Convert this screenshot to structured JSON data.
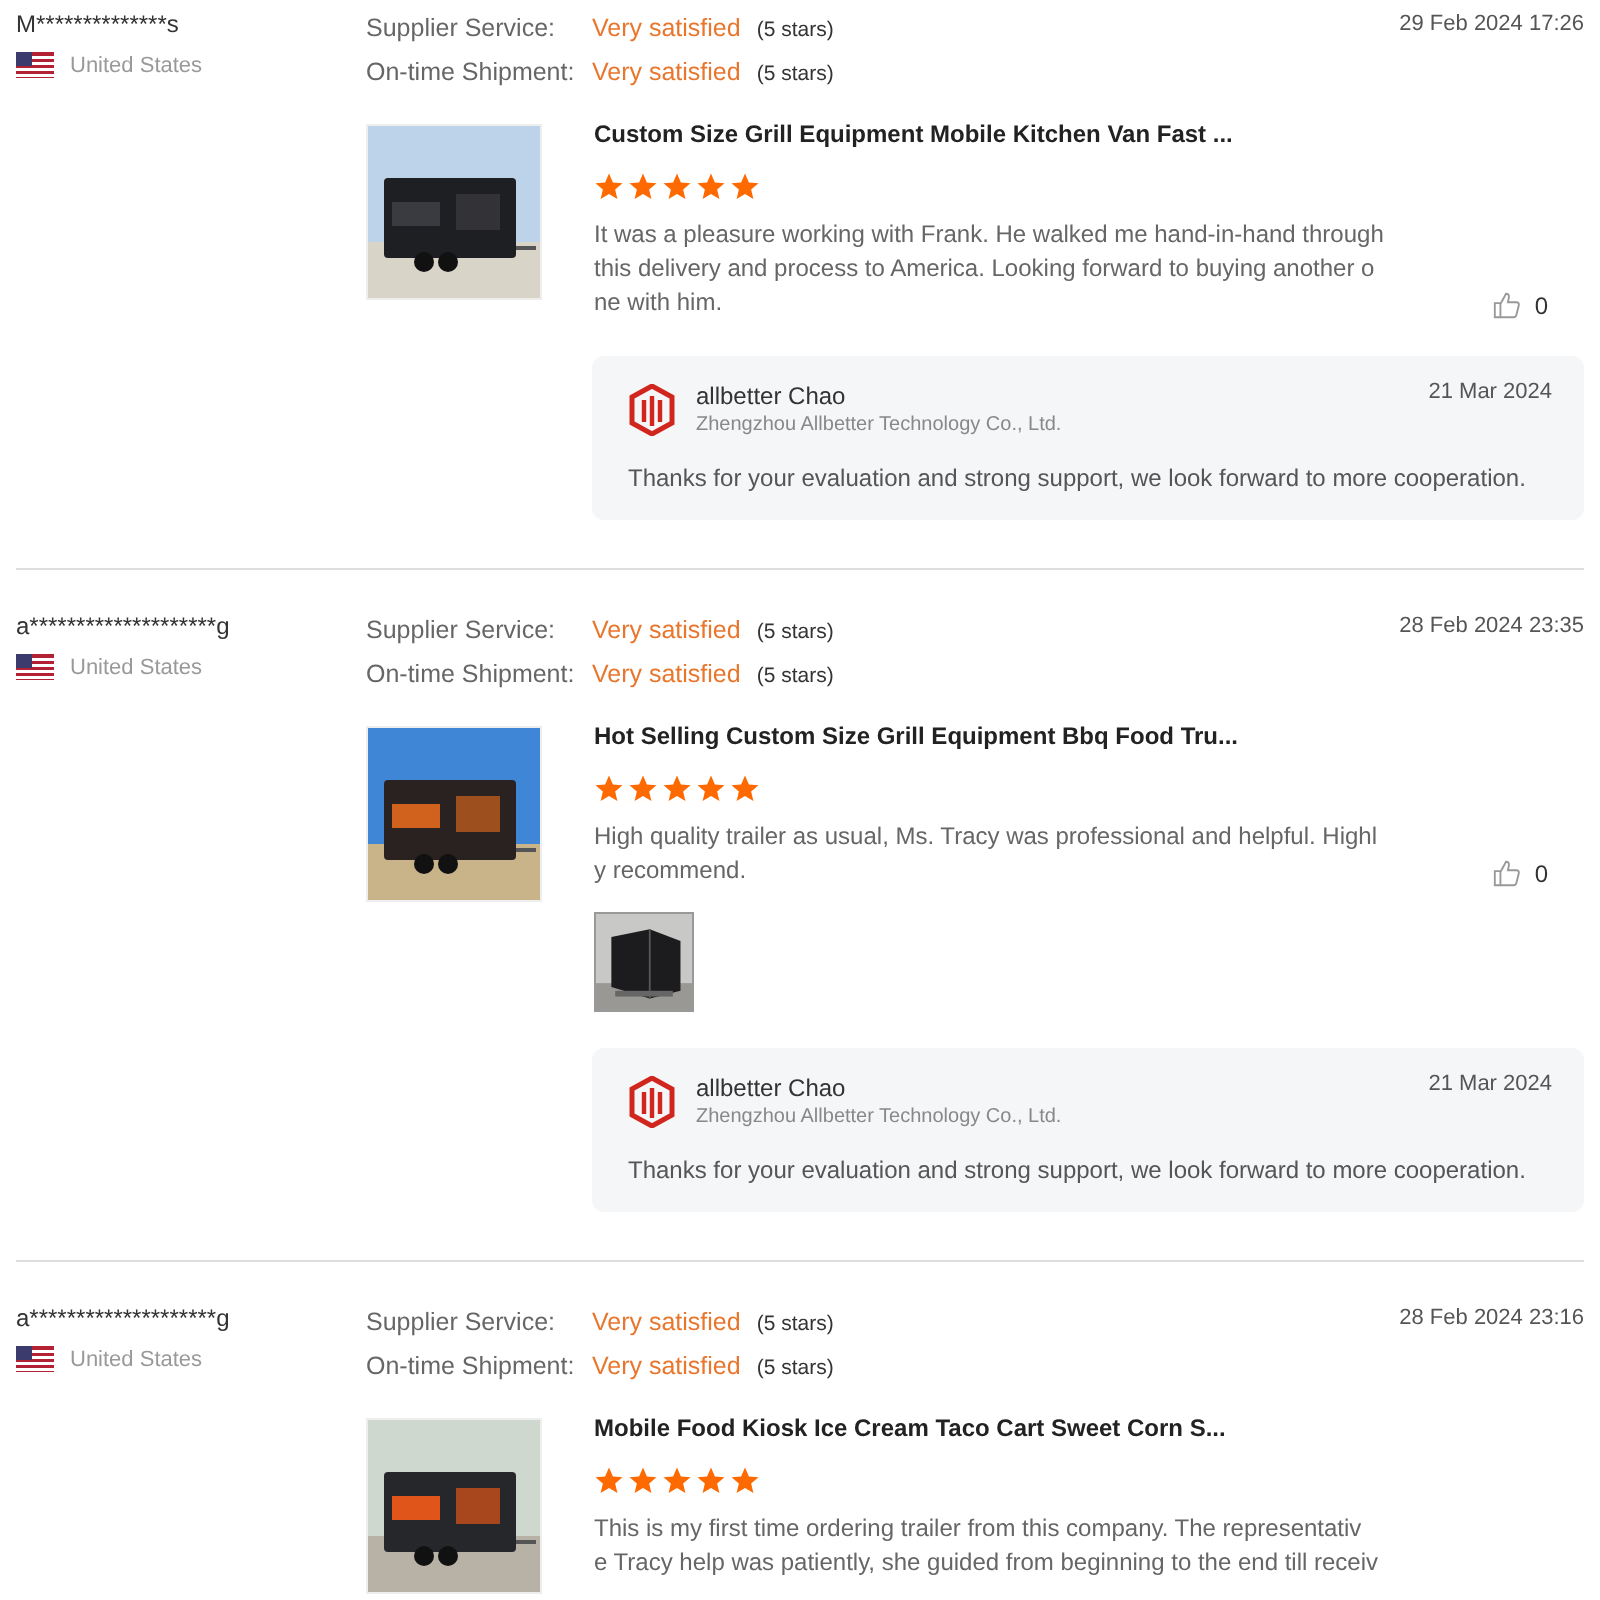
{
  "reviews": [
    {
      "buyer": "M**************s",
      "country": "United States",
      "date": "29 Feb 2024 17:26",
      "ratings": [
        {
          "label": "Supplier Service:",
          "value": "Very satisfied",
          "detail": "(5 stars)"
        },
        {
          "label": "On-time Shipment:",
          "value": "Very satisfied",
          "detail": "(5 stars)"
        }
      ],
      "product": {
        "picture": {
          "kind": "picture"
        },
        "title": "Custom Size Grill Equipment Mobile Kitchen Van Fast ...",
        "stars": 5
      },
      "text_lines": [
        "It was a pleasure working with Frank. He walked me hand-in-hand through",
        "this delivery and process to America. Looking forward to buying another o",
        "ne with him."
      ],
      "likes": "0",
      "reply": {
        "name": "allbetter Chao",
        "company": "Zhengzhou Allbetter Technology Co., Ltd.",
        "date": "21 Mar 2024",
        "text": "Thanks for your evaluation and strong support, we look forward to more cooperation."
      }
    },
    {
      "buyer": "a********************g",
      "country": "United States",
      "date": "28 Feb 2024 23:35",
      "ratings": [
        {
          "label": "Supplier Service:",
          "value": "Very satisfied",
          "detail": "(5 stars)"
        },
        {
          "label": "On-time Shipment:",
          "value": "Very satisfied",
          "detail": "(5 stars)"
        }
      ],
      "product": {
        "picture": {
          "kind": "picture"
        },
        "title": "Hot Selling Custom Size Grill Equipment Bbq Food Tru...",
        "stars": 5
      },
      "text_lines": [
        "High quality trailer as usual, Ms. Tracy was professional and helpful. Highl",
        "y recommend."
      ],
      "likes": "0",
      "attachments": [
        {
          "kind": "picture"
        }
      ],
      "reply": {
        "name": "allbetter Chao",
        "company": "Zhengzhou Allbetter Technology Co., Ltd.",
        "date": "21 Mar 2024",
        "text": "Thanks for your evaluation and strong support, we look forward to more cooperation."
      }
    },
    {
      "buyer": "a********************g",
      "country": "United States",
      "date": "28 Feb 2024 23:16",
      "ratings": [
        {
          "label": "Supplier Service:",
          "value": "Very satisfied",
          "detail": "(5 stars)"
        },
        {
          "label": "On-time Shipment:",
          "value": "Very satisfied",
          "detail": "(5 stars)"
        }
      ],
      "product": {
        "picture": {
          "kind": "picture"
        },
        "title": "Mobile Food Kiosk Ice Cream Taco Cart Sweet Corn S...",
        "stars": 5
      },
      "text_lines": [
        "This is my first time ordering trailer from this company. The representativ",
        "e Tracy help was patiently, she guided from beginning to the end till receiv"
      ]
    }
  ]
}
